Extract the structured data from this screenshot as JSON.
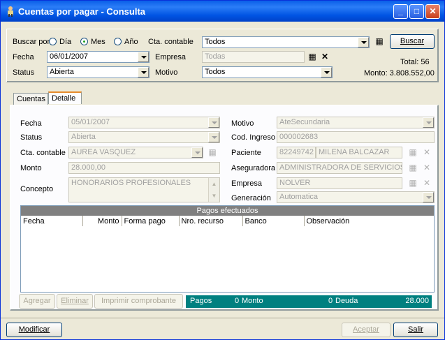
{
  "window": {
    "title": "Cuentas por pagar - Consulta",
    "title_controls": [
      "_",
      "□",
      "✕"
    ]
  },
  "filters": {
    "buscar_por_label": "Buscar por",
    "radio_dia": "Día",
    "radio_mes": "Mes",
    "radio_anio": "Año",
    "selected_period": "Mes",
    "cta_contable_label": "Cta. contable",
    "cta_contable_value": "Todos",
    "buscar_button": "Buscar",
    "fecha_label": "Fecha",
    "fecha_value": "06/01/2007",
    "empresa_label": "Empresa",
    "empresa_value": "Todas",
    "status_label": "Status",
    "status_value": "Abierta",
    "motivo_label": "Motivo",
    "motivo_value": "Todos",
    "total_text": "Total: 56",
    "monto_text": "Monto: 3.808.552,00"
  },
  "tabs": [
    {
      "label": "Cuentas",
      "active": false
    },
    {
      "label": "Detalle",
      "active": true
    }
  ],
  "detail": {
    "fecha_label": "Fecha",
    "fecha_value": "05/01/2007",
    "status_label": "Status",
    "status_value": "Abierta",
    "cta_label": "Cta. contable",
    "cta_value": "AUREA VASQUEZ",
    "monto_label": "Monto",
    "monto_value": "28.000,00",
    "concepto_label": "Concepto",
    "concepto_value": "HONORARIOS PROFESIONALES",
    "motivo_label": "Motivo",
    "motivo_value": "AteSecundaria",
    "cod_label": "Cod. Ingreso",
    "cod_value": "000002683",
    "paciente_label": "Paciente",
    "paciente_id": "82249742",
    "paciente_name": "MILENA BALCAZAR",
    "aseguradora_label": "Aseguradora",
    "aseguradora_value": "ADMINISTRADORA DE SERVICIOS",
    "empresa_label": "Empresa",
    "empresa_value": "NOLVER",
    "generacion_label": "Generación",
    "generacion_value": "Automatica"
  },
  "payments": {
    "title": "Pagos efectuados",
    "columns": [
      "Fecha",
      "Monto",
      "Forma pago",
      "Nro. recurso",
      "Banco",
      "Observación"
    ]
  },
  "payment_actions": {
    "agregar": "Agregar",
    "eliminar": "Eliminar",
    "imprimir": "Imprimir comprobante"
  },
  "summary": {
    "pagos_label": "Pagos",
    "pagos_value": "0",
    "monto_label": "Monto",
    "monto_value": "0",
    "deuda_label": "Deuda",
    "deuda_value": "28.000"
  },
  "footer": {
    "modificar": "Modificar",
    "aceptar": "Aceptar",
    "salir": "Salir"
  },
  "colors": {
    "title_bar": "#0054e3",
    "summary_bar": "#008080",
    "grid_header": "#808080"
  }
}
